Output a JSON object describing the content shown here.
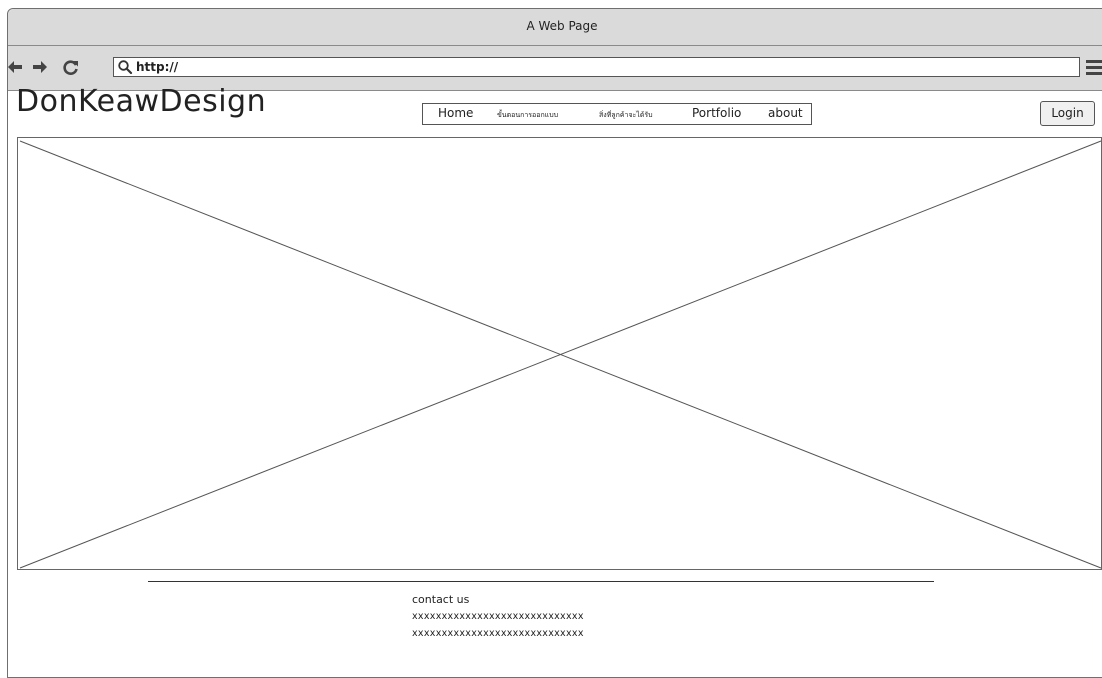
{
  "browser": {
    "title": "A Web Page",
    "url": "http://",
    "icons": [
      "back-arrow-icon",
      "forward-arrow-icon",
      "reload-icon",
      "search-icon",
      "hamburger-menu-icon"
    ]
  },
  "site": {
    "brand": "DonKeawDesign",
    "nav": [
      "Home",
      "ขั้นตอนการออกแบบ",
      "สิ่งที่ลูกค้าจะได้รับ",
      "Portfolio",
      "about"
    ],
    "login_label": "Login"
  },
  "footer": {
    "heading": "contact us",
    "lines": [
      "xxxxxxxxxxxxxxxxxxxxxxxxxxxxx",
      "xxxxxxxxxxxxxxxxxxxxxxxxxxxxx"
    ]
  }
}
